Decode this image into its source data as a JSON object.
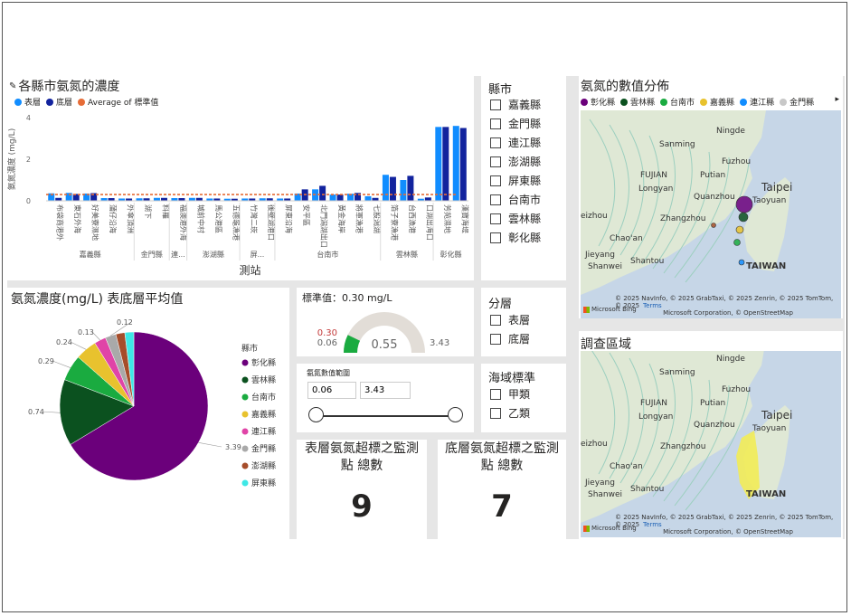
{
  "bar_card": {
    "title": "各縣市氨氮的濃度",
    "legend": {
      "surface": "表層",
      "bottom": "底層",
      "avg": "Average of 標準值"
    },
    "x_title": "測站",
    "y_title": "氨氮濃度 (mg/L)",
    "colors": {
      "surface": "#118dff",
      "bottom": "#12239e",
      "avg": "#e66c37"
    }
  },
  "pie_card": {
    "title": "氨氮濃度(mg/L) 表底層平均值",
    "legend_title": "縣市"
  },
  "gauge_card": {
    "title": "標準值：0.30 mg/L",
    "value": "0.55",
    "min": "0.06",
    "max": "3.43",
    "target": "0.30",
    "fraction": 0.145
  },
  "range_card": {
    "title": "氨氮數值範圍",
    "min": "0.06",
    "max": "3.43"
  },
  "county_slicer": {
    "title": "縣市",
    "items": [
      "嘉義縣",
      "金門縣",
      "連江縣",
      "澎湖縣",
      "屏東縣",
      "台南市",
      "雲林縣",
      "彰化縣"
    ]
  },
  "layer_slicer": {
    "title": "分層",
    "items": [
      "表層",
      "底層"
    ]
  },
  "sea_slicer": {
    "title": "海域標準",
    "items": [
      "甲類",
      "乙類"
    ]
  },
  "kpi_surface": {
    "title_l1": "表層氨氮超標之監測",
    "title_l2": "點 總數",
    "value": "9"
  },
  "kpi_bottom": {
    "title_l1": "底層氨氮超標之監測",
    "title_l2": "點 總數",
    "value": "7"
  },
  "map1": {
    "title": "氨氮的數值分佈",
    "legend": [
      {
        "name": "彰化縣",
        "color": "#6b007b"
      },
      {
        "name": "雲林縣",
        "color": "#0b511f"
      },
      {
        "name": "台南市",
        "color": "#1aab40"
      },
      {
        "name": "嘉義縣",
        "color": "#e8c22e"
      },
      {
        "name": "連江縣",
        "color": "#118dff"
      },
      {
        "name": "金門縣",
        "color": "#c8c8c8"
      }
    ],
    "more_icon": "chevron-right-icon"
  },
  "map2": {
    "title": "調查區域"
  },
  "map_labels": {
    "ningde": "Ningde",
    "sanming": "Sanming",
    "fuzhou": "Fuzhou",
    "fujian": "FUJIAN",
    "putian": "Putian",
    "longyan": "Longyan",
    "quanzhou": "Quanzhou",
    "taipei": "Taipei",
    "taoyuan": "Taoyuan",
    "zhangzhou": "Zhangzhou",
    "eizhou": "eizhou",
    "chaoan": "Chao'an",
    "jieyang": "Jieyang",
    "shanwei": "Shanwei",
    "shantou": "Shantou",
    "taiwan": "TAIWAN"
  },
  "attribution": {
    "line1": "© 2025 NavInfo, © 2025 GrabTaxi, © 2025 Zenrin, © 2025 TomTom, © 2025",
    "terms": "Terms",
    "line2": "Microsoft Corporation, © OpenStreetMap",
    "bing": "Microsoft Bing"
  },
  "chart_data": [
    {
      "type": "bar",
      "title": "各縣市氨氮的濃度",
      "xlabel": "測站",
      "ylabel": "氨氮濃度 (mg/L)",
      "ylim": [
        0,
        4
      ],
      "yticks": [
        0,
        2,
        4
      ],
      "grid": false,
      "legend_position": "top-left",
      "categories": [
        "布袋商港外",
        "東石外海",
        "好美寮濕地",
        "蒲仔沿海",
        "外傘頂洲",
        "湖下",
        "料羅",
        "福澳港外海",
        "城前中村",
        "馬公港區",
        "五德龜漁港",
        "竹灣二崁",
        "後壁湖港口",
        "屏東沿海",
        "安平區",
        "北門潟湖出口",
        "黃金海岸",
        "將軍漁港",
        "七股潟湖",
        "箔子寮漁港",
        "台西漁港",
        "口湖出海口",
        "芳苑濕地",
        "漢寶海堤"
      ],
      "groups": [
        {
          "name": "嘉義縣",
          "count": 5
        },
        {
          "name": "金門縣",
          "count": 2
        },
        {
          "name": "連...",
          "count": 1
        },
        {
          "name": "澎湖縣",
          "count": 3
        },
        {
          "name": "屏...",
          "count": 2
        },
        {
          "name": "台南市",
          "count": 6
        },
        {
          "name": "雲林縣",
          "count": 3
        },
        {
          "name": "彰化縣",
          "count": 2
        }
      ],
      "series": [
        {
          "name": "表層",
          "values": [
            0.36,
            0.38,
            0.35,
            0.13,
            0.11,
            0.12,
            0.14,
            0.13,
            0.14,
            0.11,
            0.1,
            0.11,
            0.12,
            0.11,
            0.35,
            0.55,
            0.3,
            0.34,
            0.22,
            1.25,
            1.0,
            0.1,
            3.55,
            3.6
          ]
        },
        {
          "name": "底層",
          "values": [
            0.14,
            0.33,
            0.37,
            0.13,
            0.11,
            0.12,
            0.14,
            0.13,
            0.14,
            0.11,
            0.1,
            0.11,
            0.12,
            0.11,
            0.55,
            0.72,
            0.3,
            0.38,
            0.14,
            1.15,
            1.2,
            0.16,
            3.55,
            3.5
          ]
        }
      ],
      "average_line": {
        "name": "Average of 標準值",
        "value": 0.3
      }
    },
    {
      "type": "pie",
      "title": "氨氮濃度(mg/L) 表底層平均值",
      "legend_title": "縣市",
      "legend_position": "right",
      "slices": [
        {
          "name": "彰化縣",
          "value": 3.39,
          "color": "#6b007b"
        },
        {
          "name": "雲林縣",
          "value": 0.74,
          "color": "#0b511f"
        },
        {
          "name": "台南市",
          "value": 0.29,
          "color": "#1aab40"
        },
        {
          "name": "嘉義縣",
          "value": 0.24,
          "color": "#e8c22e"
        },
        {
          "name": "連江縣",
          "value": 0.13,
          "color": "#e044a7"
        },
        {
          "name": "金門縣",
          "value": 0.12,
          "color": "#a9a9a9"
        },
        {
          "name": "澎湖縣",
          "value": 0.1,
          "color": "#a64d2a"
        },
        {
          "name": "屏東縣",
          "value": 0.1,
          "color": "#3ee8e6"
        }
      ],
      "labels_shown": [
        "3.39",
        "0.74",
        "0.29",
        "0.24",
        "0.13",
        "0.12"
      ]
    }
  ]
}
